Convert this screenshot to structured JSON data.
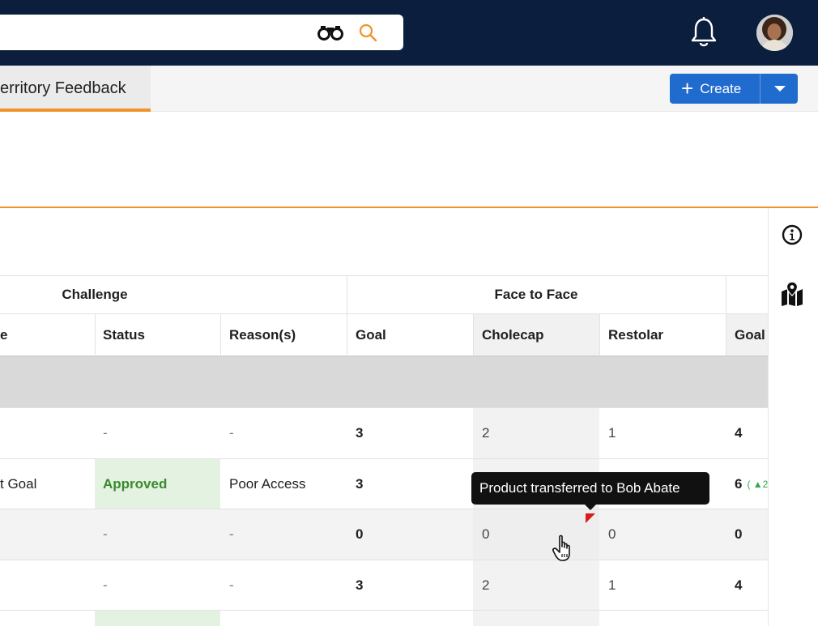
{
  "header": {
    "search_placeholder": "",
    "search_value": ""
  },
  "tabs": {
    "active_label": "erritory Feedback"
  },
  "create_button": {
    "label": "Create"
  },
  "table": {
    "groups": {
      "challenge": "Challenge",
      "face_to_face": "Face to Face"
    },
    "columns": {
      "truncated_left": "e",
      "status": "Status",
      "reasons": "Reason(s)",
      "goal": "Goal",
      "cholecap": "Cholecap",
      "restolar": "Restolar",
      "goal2": "Goal"
    },
    "rows": [
      {
        "c0": "",
        "status": "-",
        "reasons": "-",
        "goal": "3",
        "cholecap": "2",
        "restolar": "1",
        "goal2": "4",
        "trend": ""
      },
      {
        "c0": "t Goal",
        "status": "Approved",
        "reasons": "Poor Access",
        "goal": "3",
        "cholecap": "",
        "restolar": "",
        "goal2": "6",
        "trend": "( ▲2"
      },
      {
        "c0": "",
        "status": "-",
        "reasons": "-",
        "goal": "0",
        "cholecap": "0",
        "restolar": "0",
        "goal2": "0",
        "trend": ""
      },
      {
        "c0": "",
        "status": "-",
        "reasons": "-",
        "goal": "3",
        "cholecap": "2",
        "restolar": "1",
        "goal2": "4",
        "trend": ""
      }
    ]
  },
  "tooltip": {
    "text": "Product transferred to Bob Abate"
  },
  "colors": {
    "navy": "#0b1e3d",
    "accent_orange": "#f0932b",
    "primary_blue": "#1f6bce",
    "approved_green": "#3b8a2e",
    "approved_bg": "#e3f2e1"
  },
  "icons": [
    "binoculars-icon",
    "search-icon",
    "bell-icon",
    "avatar",
    "plus-icon",
    "chevron-down-icon",
    "info-icon",
    "map-icon",
    "pointer-hand-icon"
  ]
}
